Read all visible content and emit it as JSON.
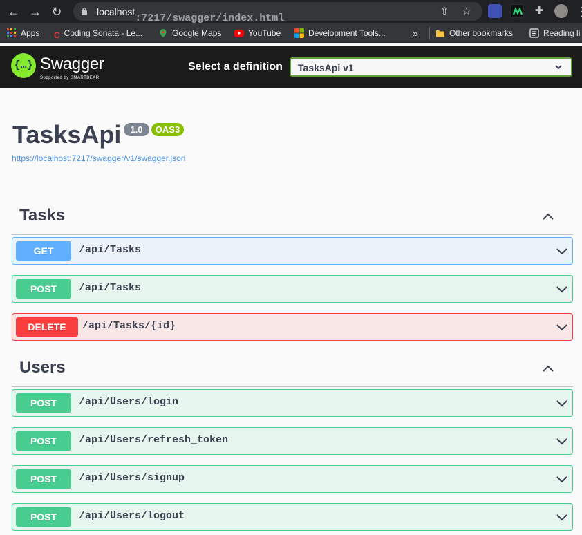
{
  "browser": {
    "url_host": "localhost",
    "url_path": ":7217/swagger/index.html",
    "bookmarks": [
      {
        "label": "Apps",
        "color": "#e8eaed"
      },
      {
        "label": "Coding Sonata - Le...",
        "color": "#e53935"
      },
      {
        "label": "Google Maps",
        "color": "#34a853"
      },
      {
        "label": "YouTube",
        "color": "#ff0000"
      },
      {
        "label": "Development Tools...",
        "color": "#f25022"
      },
      {
        "label": "Other bookmarks",
        "color": "#f6c343"
      },
      {
        "label": "Reading li",
        "color": "#e8eaed"
      }
    ],
    "overflow": "»"
  },
  "topbar": {
    "logo_text": "Swagger",
    "logo_sub": "Supported by SMARTBEAR",
    "select_label": "Select a definition",
    "selected_definition": "TasksApi v1"
  },
  "info": {
    "title": "TasksApi",
    "version_badge": "1.0",
    "oas_badge": "OAS3",
    "spec_url": "https://localhost:7217/swagger/v1/swagger.json"
  },
  "tags": [
    {
      "name": "Tasks",
      "operations": [
        {
          "method": "GET",
          "path": "/api/Tasks"
        },
        {
          "method": "POST",
          "path": "/api/Tasks"
        },
        {
          "method": "DELETE",
          "path": "/api/Tasks/{id}"
        }
      ]
    },
    {
      "name": "Users",
      "operations": [
        {
          "method": "POST",
          "path": "/api/Users/login"
        },
        {
          "method": "POST",
          "path": "/api/Users/refresh_token"
        },
        {
          "method": "POST",
          "path": "/api/Users/signup"
        },
        {
          "method": "POST",
          "path": "/api/Users/logout"
        }
      ]
    }
  ],
  "colors": {
    "get": "#61affe",
    "post": "#49cc90",
    "delete": "#f93e3e",
    "swagger_green": "#85ea2d"
  }
}
